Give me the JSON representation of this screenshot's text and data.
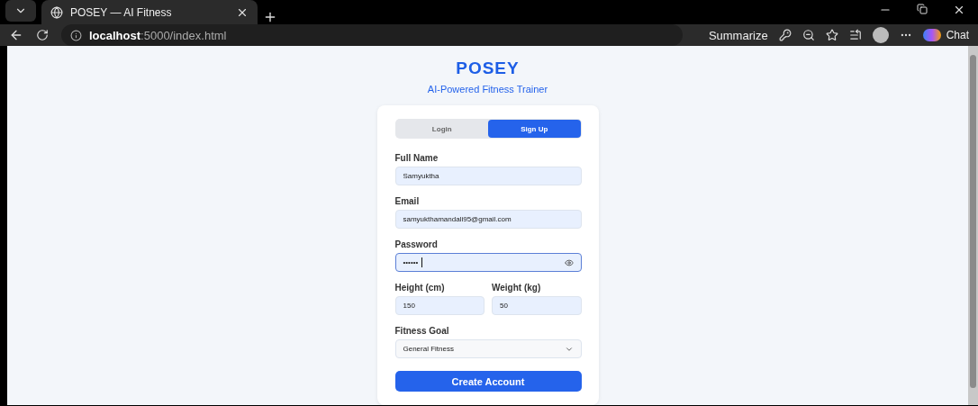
{
  "browser": {
    "tab": {
      "title": "POSEY — AI Fitness"
    },
    "url": {
      "host": "localhost",
      "rest": ":5000/index.html"
    },
    "summarize": "Summarize",
    "chat": "Chat"
  },
  "header": {
    "title": "POSEY",
    "subtitle": "AI-Powered Fitness Trainer"
  },
  "auth_tabs": [
    {
      "label": "Login",
      "selected": false
    },
    {
      "label": "Sign Up",
      "selected": true
    }
  ],
  "form": {
    "full_name": {
      "label": "Full Name",
      "value": "Samyuktha"
    },
    "email": {
      "label": "Email",
      "value": "samyukthamandali95@gmail.com"
    },
    "password": {
      "label": "Password",
      "value": "••••••",
      "focused": true
    },
    "height": {
      "label": "Height (cm)",
      "value": "150"
    },
    "weight": {
      "label": "Weight (kg)",
      "value": "50"
    },
    "goal": {
      "label": "Fitness Goal",
      "value": "General Fitness"
    },
    "submit": "Create Account"
  }
}
